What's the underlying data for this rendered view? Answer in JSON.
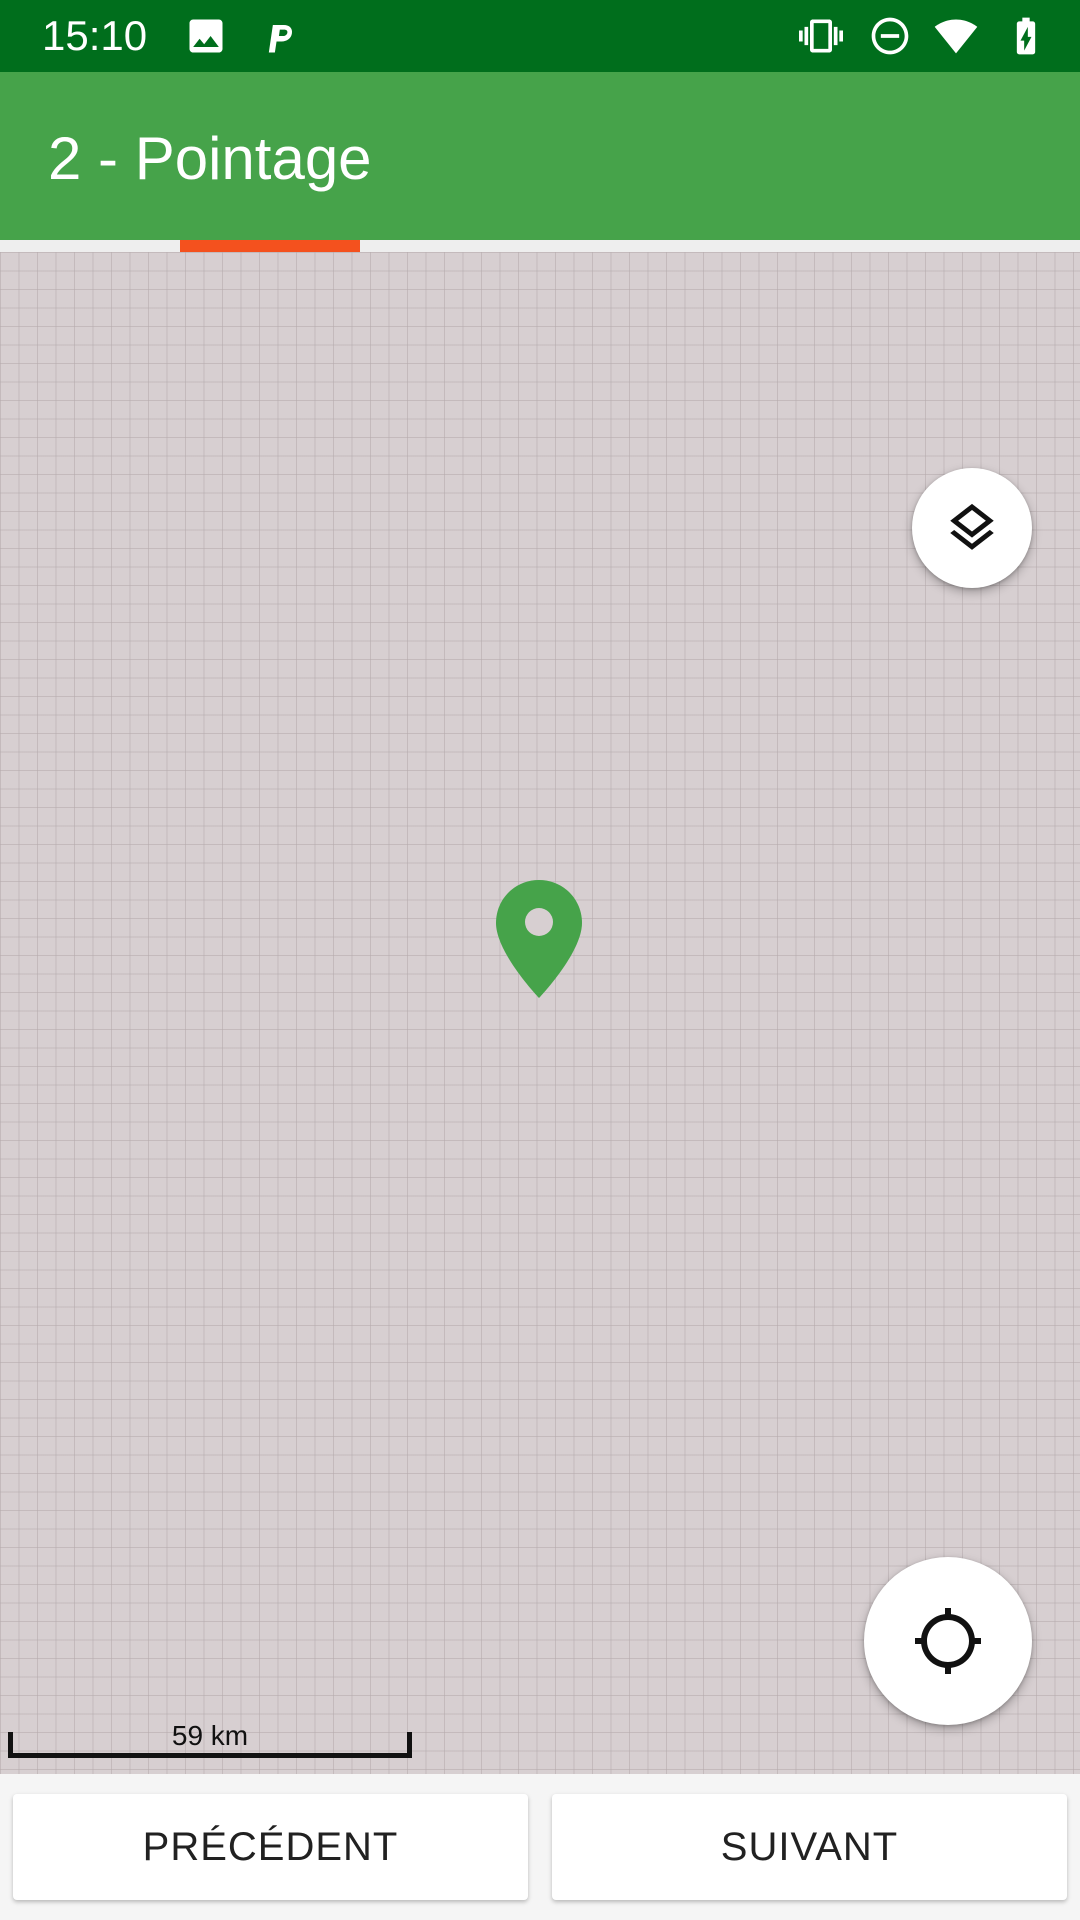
{
  "status_bar": {
    "time": "15:10",
    "icons": [
      "image-icon",
      "p-app-icon",
      "vibrate-icon",
      "do-not-disturb-icon",
      "wifi-icon",
      "battery-charging-icon"
    ],
    "background_color": "#006e1c"
  },
  "app_bar": {
    "title": "2 - Pointage",
    "background_color": "#46a34a"
  },
  "progress": {
    "indicator_color": "#f4511e",
    "current_step": 2
  },
  "map": {
    "layers_button_icon": "layers-icon",
    "locate_button_icon": "crosshair-icon",
    "marker_icon": "map-pin-icon",
    "marker_color": "#46a34a",
    "scale_label": "59 km"
  },
  "buttons": {
    "previous_label": "PRÉCÉDENT",
    "next_label": "SUIVANT"
  }
}
